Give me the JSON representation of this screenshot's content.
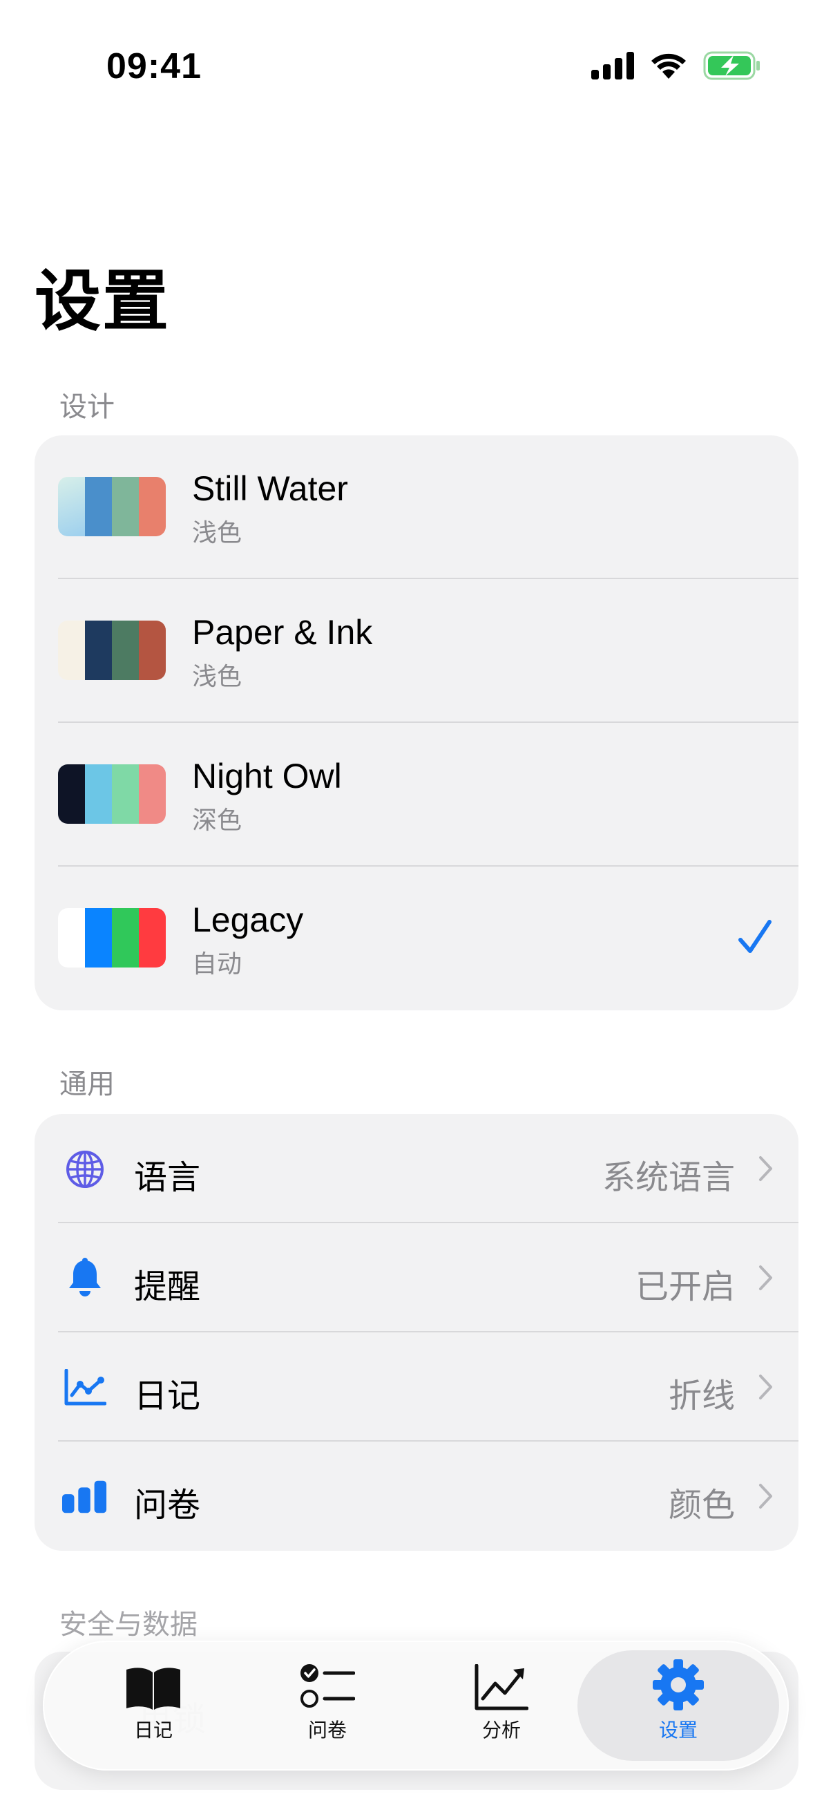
{
  "status_bar": {
    "time": "09:41"
  },
  "page_title": "设置",
  "sections": {
    "design": {
      "header": "设计",
      "themes": [
        {
          "name": "Still Water",
          "mode": "浅色",
          "colors": [
            "#b8e0ec",
            "#4a8fcb",
            "#7fb69a",
            "#e8806c"
          ],
          "selected": false
        },
        {
          "name": "Paper & Ink",
          "mode": "浅色",
          "colors": [
            "#f6f1e6",
            "#1e3a5f",
            "#4d7b62",
            "#b45541"
          ],
          "selected": false
        },
        {
          "name": "Night Owl",
          "mode": "深色",
          "colors": [
            "#0e1426",
            "#6cc6e6",
            "#7fd9a6",
            "#f08a86"
          ],
          "selected": false
        },
        {
          "name": "Legacy",
          "mode": "自动",
          "colors": [
            "#ffffff",
            "#0a84ff",
            "#30c85a",
            "#ff3b40"
          ],
          "selected": true
        }
      ]
    },
    "general": {
      "header": "通用",
      "rows": [
        {
          "icon": "globe-icon",
          "label": "语言",
          "value": "系统语言"
        },
        {
          "icon": "bell-icon",
          "label": "提醒",
          "value": "已开启"
        },
        {
          "icon": "line-chart-icon",
          "label": "日记",
          "value": "折线"
        },
        {
          "icon": "bar-chart-icon",
          "label": "问卷",
          "value": "颜色"
        }
      ]
    },
    "security": {
      "header": "安全与数据",
      "partial_row_label": "用锁"
    }
  },
  "tab_bar": {
    "tabs": [
      {
        "icon": "book-icon",
        "label": "日记",
        "active": false
      },
      {
        "icon": "checklist-icon",
        "label": "问卷",
        "active": false
      },
      {
        "icon": "trend-icon",
        "label": "分析",
        "active": false
      },
      {
        "icon": "gear-icon",
        "label": "设置",
        "active": true
      }
    ]
  },
  "colors": {
    "accent": "#1877f2",
    "globe": "#5e5ce6",
    "secondary_text": "#8a8a8e"
  }
}
